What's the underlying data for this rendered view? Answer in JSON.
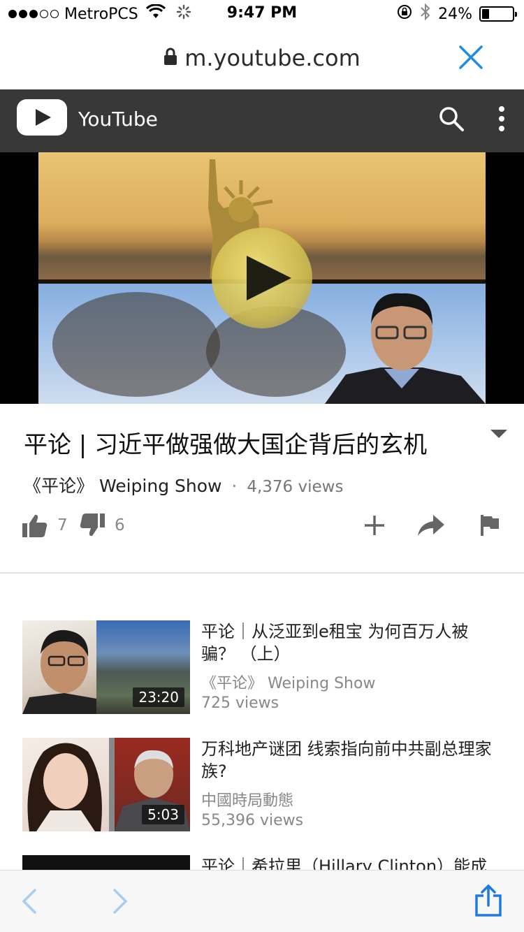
{
  "status_bar": {
    "carrier": "MetroPCS",
    "time": "9:47 PM",
    "battery_percent": "24%",
    "battery_level": 0.24,
    "icons": [
      "signal-dots",
      "wifi-icon",
      "loading-spinner",
      "rotation-lock-icon",
      "bluetooth-icon",
      "battery-icon"
    ]
  },
  "browser": {
    "url": "m.youtube.com",
    "icons": [
      "lock-icon",
      "close-icon"
    ]
  },
  "header": {
    "brand": "YouTube",
    "icons": [
      "youtube-logo-icon",
      "search-icon",
      "more-vert-icon"
    ],
    "background": "#383838"
  },
  "video": {
    "title": "平论 | 习近平做强做大国企背后的玄机",
    "channel": "《平论》 Weiping Show",
    "separator": "·",
    "views": "4,376 views",
    "likes": "7",
    "dislikes": "6",
    "icons": [
      "play-icon",
      "expand-icon",
      "thumbs-up-icon",
      "thumbs-down-icon",
      "add-icon",
      "share-icon",
      "flag-icon"
    ]
  },
  "related": [
    {
      "title": "平论｜从泛亚到e租宝 为何百万人被骗？ （上）",
      "channel": "《平论》 Weiping Show",
      "views": "725 views",
      "duration": "23:20"
    },
    {
      "title": "万科地产谜团 线索指向前中共副总理家族?",
      "channel": "中國時局動態",
      "views": "55,396 views",
      "duration": "5:03"
    },
    {
      "title": "平论｜希拉里（Hillary Clinton）能成",
      "channel": "",
      "views": "",
      "duration": ""
    }
  ],
  "toolbar": {
    "icons": [
      "back-icon",
      "forward-icon",
      "share-icon"
    ],
    "accent": "#1f7ae0"
  }
}
